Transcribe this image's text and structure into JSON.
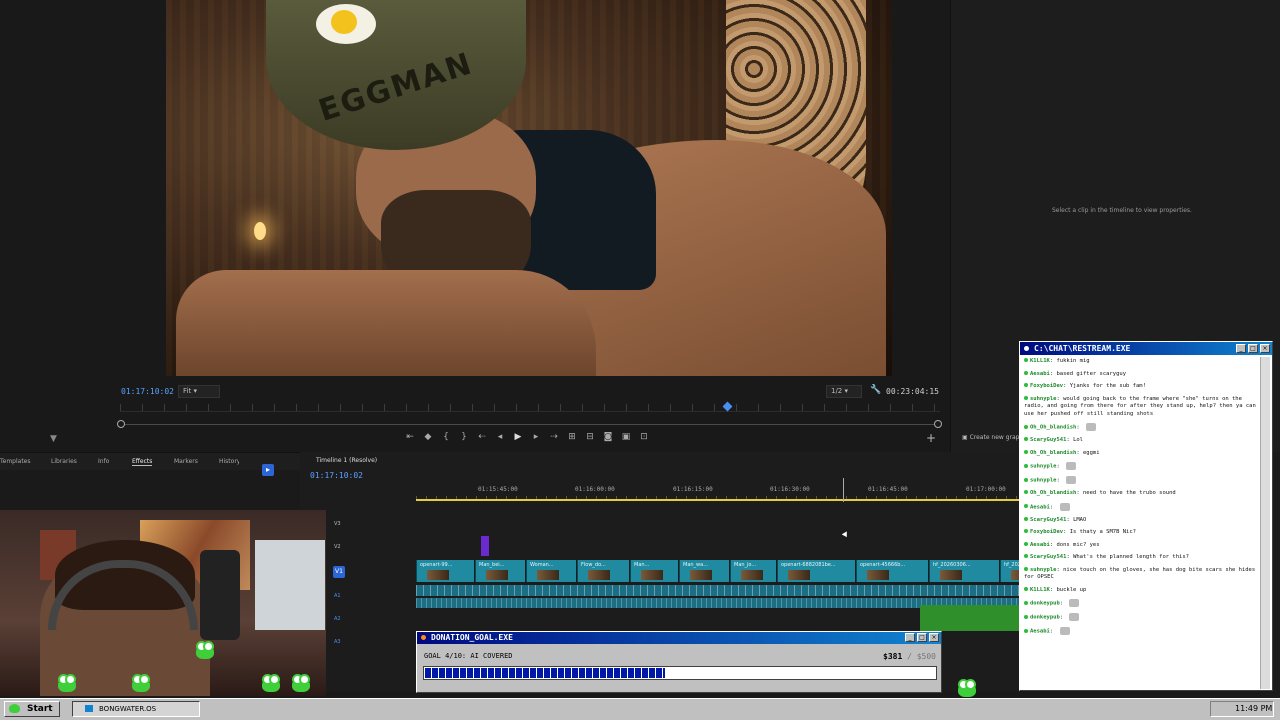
{
  "monitor": {
    "timecode_left": "01:17:10:02",
    "fit_label": "Fit",
    "quality_label": "1/2",
    "timecode_right": "00:23:04:15",
    "video_helmet_text": "EGGMAN"
  },
  "properties": {
    "message": "Select a clip in the timeline to view properties.",
    "create_graphic": "Create new grap"
  },
  "panel_tabs": [
    "Templates",
    "Libraries",
    "Info",
    "Effects",
    "Markers",
    "History"
  ],
  "timeline": {
    "tab_label": "Timeline 1 (Resolve)",
    "timecode": "01:17:10:02",
    "ruler_times": [
      "01:15:45:00",
      "01:16:00:00",
      "01:16:15:00",
      "01:16:30:00",
      "01:16:45:00",
      "01:17:00:00"
    ],
    "tracks": [
      "V3",
      "V2",
      "V1",
      "A1",
      "A2",
      "A3"
    ],
    "clips": [
      "openart-99...",
      "Man_bei...",
      "Woman...",
      "Flow_do...",
      "Man...",
      "Man_wa...",
      "Man_jo...",
      "openart-6882081be...",
      "openart-45666b...",
      "hf_20260306...",
      "hf_202"
    ]
  },
  "donation": {
    "title": "DONATION_GOAL.EXE",
    "goal_label": "GOAL 4/10: AI COVERED",
    "current": "$381",
    "total": "/ $500",
    "progress_fraction": 0.47
  },
  "chat": {
    "title": "C:\\CHAT\\RESTREAM.EXE",
    "messages": [
      {
        "user": "K1LL1K",
        "text": "fukkin mig"
      },
      {
        "user": "Aesabi",
        "text": "based gifter scaryguy"
      },
      {
        "user": "FoxyboiDev",
        "text": "Yjanks for the sub fam!"
      },
      {
        "user": "suhnyple",
        "text": "would going back to the frame where \"she\" turns on the radio, and going from there for after they stand up, help? then ya can use her pushed off still standing shots"
      },
      {
        "user": "Oh_Oh_blandish",
        "text": ""
      },
      {
        "user": "ScaryGuy541",
        "text": "Lol"
      },
      {
        "user": "Oh_Oh_blandish",
        "text": "eggmi"
      },
      {
        "user": "suhnyple",
        "text": ""
      },
      {
        "user": "suhnyple",
        "text": ""
      },
      {
        "user": "Oh_Oh_blandish",
        "text": "need to have the trubo sound"
      },
      {
        "user": "Aesabi",
        "text": ""
      },
      {
        "user": "ScaryGuy541",
        "text": "LMAO"
      },
      {
        "user": "FoxyboiDev",
        "text": "Is thaty a SM7B Nic?"
      },
      {
        "user": "Aesabi",
        "text": "dons mic? yes"
      },
      {
        "user": "ScaryGuy541",
        "text": "What's the planned length for this?"
      },
      {
        "user": "suhnyple",
        "text": "nice touch on the gloves, she has dog bite scars she hides for OPSEC"
      },
      {
        "user": "K1LL1K",
        "text": "buckle up"
      },
      {
        "user": "donkeypub",
        "text": ""
      },
      {
        "user": "donkeypub",
        "text": ""
      },
      {
        "user": "Aesabi",
        "text": ""
      }
    ]
  },
  "taskbar": {
    "start_label": "Start",
    "app_label": "BONGWATER.OS",
    "clock": "11:49 PM"
  }
}
